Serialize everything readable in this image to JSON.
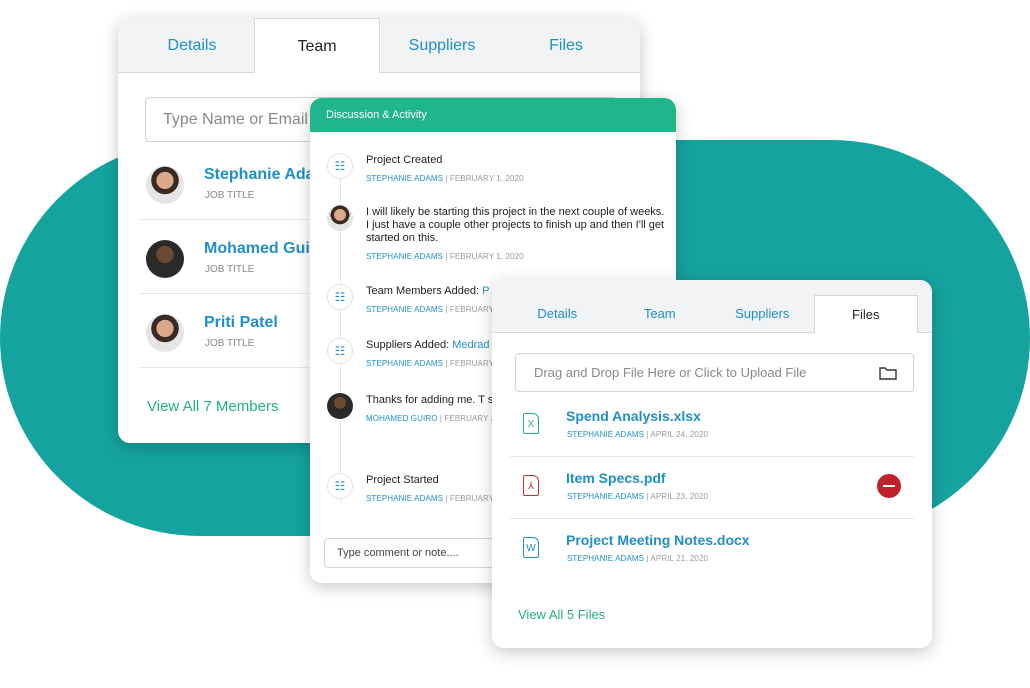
{
  "team_card": {
    "tabs": [
      "Details",
      "Team",
      "Suppliers",
      "Files"
    ],
    "active_tab": "Team",
    "search_placeholder": "Type Name or Email to Add",
    "members": [
      {
        "name": "Stephanie Adams",
        "title": "JOB TITLE"
      },
      {
        "name": "Mohamed Guiro",
        "title": "JOB TITLE"
      },
      {
        "name": "Priti Patel",
        "title": "JOB TITLE"
      }
    ],
    "view_all": "View All 7 Members"
  },
  "discussion_card": {
    "title": "Discussion & Activity",
    "items": [
      {
        "type": "activity",
        "text": "Project Created",
        "link": "",
        "who": "STEPHANIE ADAMS",
        "date": "FEBRUARY 1, 2020"
      },
      {
        "type": "comment",
        "text": "I will likely be starting this project in the next couple of weeks.  I just have a couple other projects to finish up and then I'll get started on this.",
        "link": "",
        "who": "STEPHANIE ADAMS",
        "date": "FEBRUARY 1, 2020"
      },
      {
        "type": "activity",
        "text": "Team Members Added: ",
        "link": "P",
        "who": "STEPHANIE ADAMS",
        "date": "FEBRUARY 2, 2020"
      },
      {
        "type": "activity",
        "text": "Suppliers Added: ",
        "link": "Medrad",
        "who": "STEPHANIE ADAMS",
        "date": "FEBRUARY 2, 2020"
      },
      {
        "type": "comment",
        "text": "Thanks for adding me.  T since we have our busine weeks.",
        "link": "",
        "who": "MOHAMED GUIRO",
        "date": "FEBRUARY 3, 2020"
      },
      {
        "type": "activity",
        "text": "Project Started",
        "link": "",
        "who": "STEPHANIE ADAMS",
        "date": "FEBRUARY 13, 2020"
      }
    ],
    "comment_placeholder": "Type comment or note...."
  },
  "files_card": {
    "tabs": [
      "Details",
      "Team",
      "Suppliers",
      "Files"
    ],
    "active_tab": "Files",
    "upload_placeholder": "Drag and Drop File Here or Click to Upload File",
    "files": [
      {
        "name": "Spend Analysis.xlsx",
        "icon": "excel-file-icon",
        "letter": "X",
        "color": "#22b07d",
        "who": "STEPHANIE ADAMS",
        "date": "APRIL 24, 2020"
      },
      {
        "name": "Item Specs.pdf",
        "icon": "pdf-file-icon",
        "letter": "⅄",
        "color": "#c9302c",
        "who": "STEPHANIE ADAMS",
        "date": "APRIL 23, 2020"
      },
      {
        "name": "Project Meeting Notes.docx",
        "icon": "word-file-icon",
        "letter": "W",
        "color": "#1e8fc8",
        "who": "STEPHANIE ADAMS",
        "date": "APRIL 21, 2020"
      }
    ],
    "view_all": "View All 5 Files"
  },
  "colors": {
    "teal": "#15a39f",
    "green_header": "#20b68c",
    "link": "#1e8fc8",
    "delete": "#c0202c"
  }
}
